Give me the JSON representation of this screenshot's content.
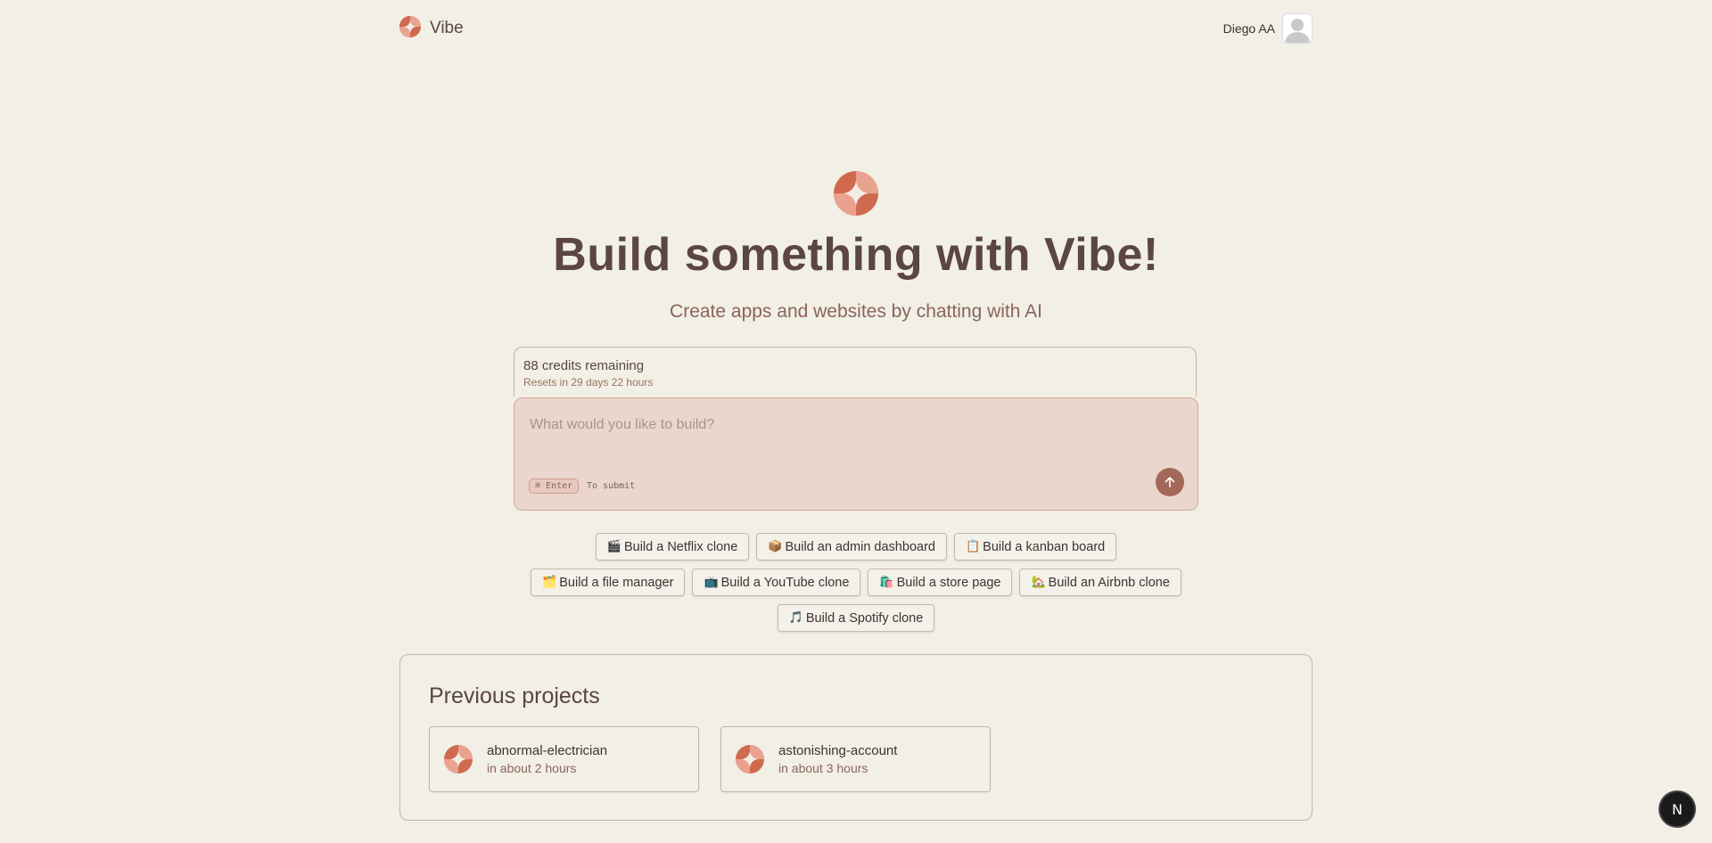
{
  "header": {
    "brand_name": "Vibe",
    "user_name": "Diego AA"
  },
  "hero": {
    "title": "Build something with Vibe!",
    "subtitle": "Create apps and websites by chatting with AI"
  },
  "credits": {
    "remaining": "88 credits remaining",
    "resets": "Resets in 29 days 22 hours"
  },
  "prompt": {
    "placeholder": "What would you like to build?",
    "value": "",
    "shortcut": "⌘ Enter",
    "shortcut_hint": "To submit"
  },
  "suggestions": {
    "row1": [
      {
        "emoji": "🎬",
        "label": "Build a Netflix clone"
      },
      {
        "emoji": "📦",
        "label": "Build an admin dashboard"
      },
      {
        "emoji": "📋",
        "label": "Build a kanban board"
      }
    ],
    "row2": [
      {
        "emoji": "🗂️",
        "label": "Build a file manager"
      },
      {
        "emoji": "📺",
        "label": "Build a YouTube clone"
      },
      {
        "emoji": "🛍️",
        "label": "Build a store page"
      },
      {
        "emoji": "🏡",
        "label": "Build an Airbnb clone"
      }
    ],
    "row3": [
      {
        "emoji": "🎵",
        "label": "Build a Spotify clone"
      }
    ]
  },
  "projects": {
    "title": "Previous projects",
    "items": [
      {
        "name": "abnormal-electrician",
        "time": "in about 2 hours"
      },
      {
        "name": "astonishing-account",
        "time": "in about 3 hours"
      }
    ]
  },
  "dev_badge": {
    "label": "N"
  },
  "colors": {
    "background": "#f1efe6",
    "accent": "#cf6a4e",
    "accent_light": "#e9a28e",
    "prompt_bg": "#ead6cc",
    "submit_button": "#a4685a",
    "title_text": "#5b4640"
  }
}
